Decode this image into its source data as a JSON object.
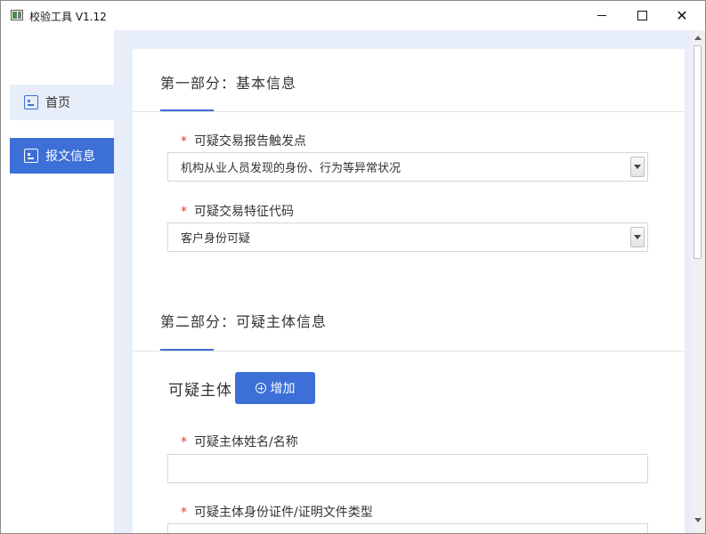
{
  "window": {
    "title": "校验工具 V1.12"
  },
  "sidebar": {
    "items": [
      {
        "label": "首页",
        "icon": "form-icon"
      },
      {
        "label": "报文信息",
        "icon": "form-icon"
      }
    ]
  },
  "section1": {
    "title": "第一部分：基本信息",
    "fields": [
      {
        "label": "可疑交易报告触发点",
        "value": "机构从业人员发现的身份、行为等异常状况",
        "required": true
      },
      {
        "label": "可疑交易特征代码",
        "value": "客户身份可疑",
        "required": true
      }
    ]
  },
  "section2": {
    "title": "第二部分：可疑主体信息",
    "subject_label": "可疑主体",
    "add_button": "增加",
    "fields": [
      {
        "label": "可疑主体姓名/名称",
        "value": "",
        "required": true
      },
      {
        "label": "可疑主体身份证件/证明文件类型",
        "required": true
      }
    ]
  },
  "required_mark": "*",
  "colors": {
    "accent": "#3c6fd7",
    "required": "#ee3333",
    "panel_bg": "#e8eef9"
  }
}
